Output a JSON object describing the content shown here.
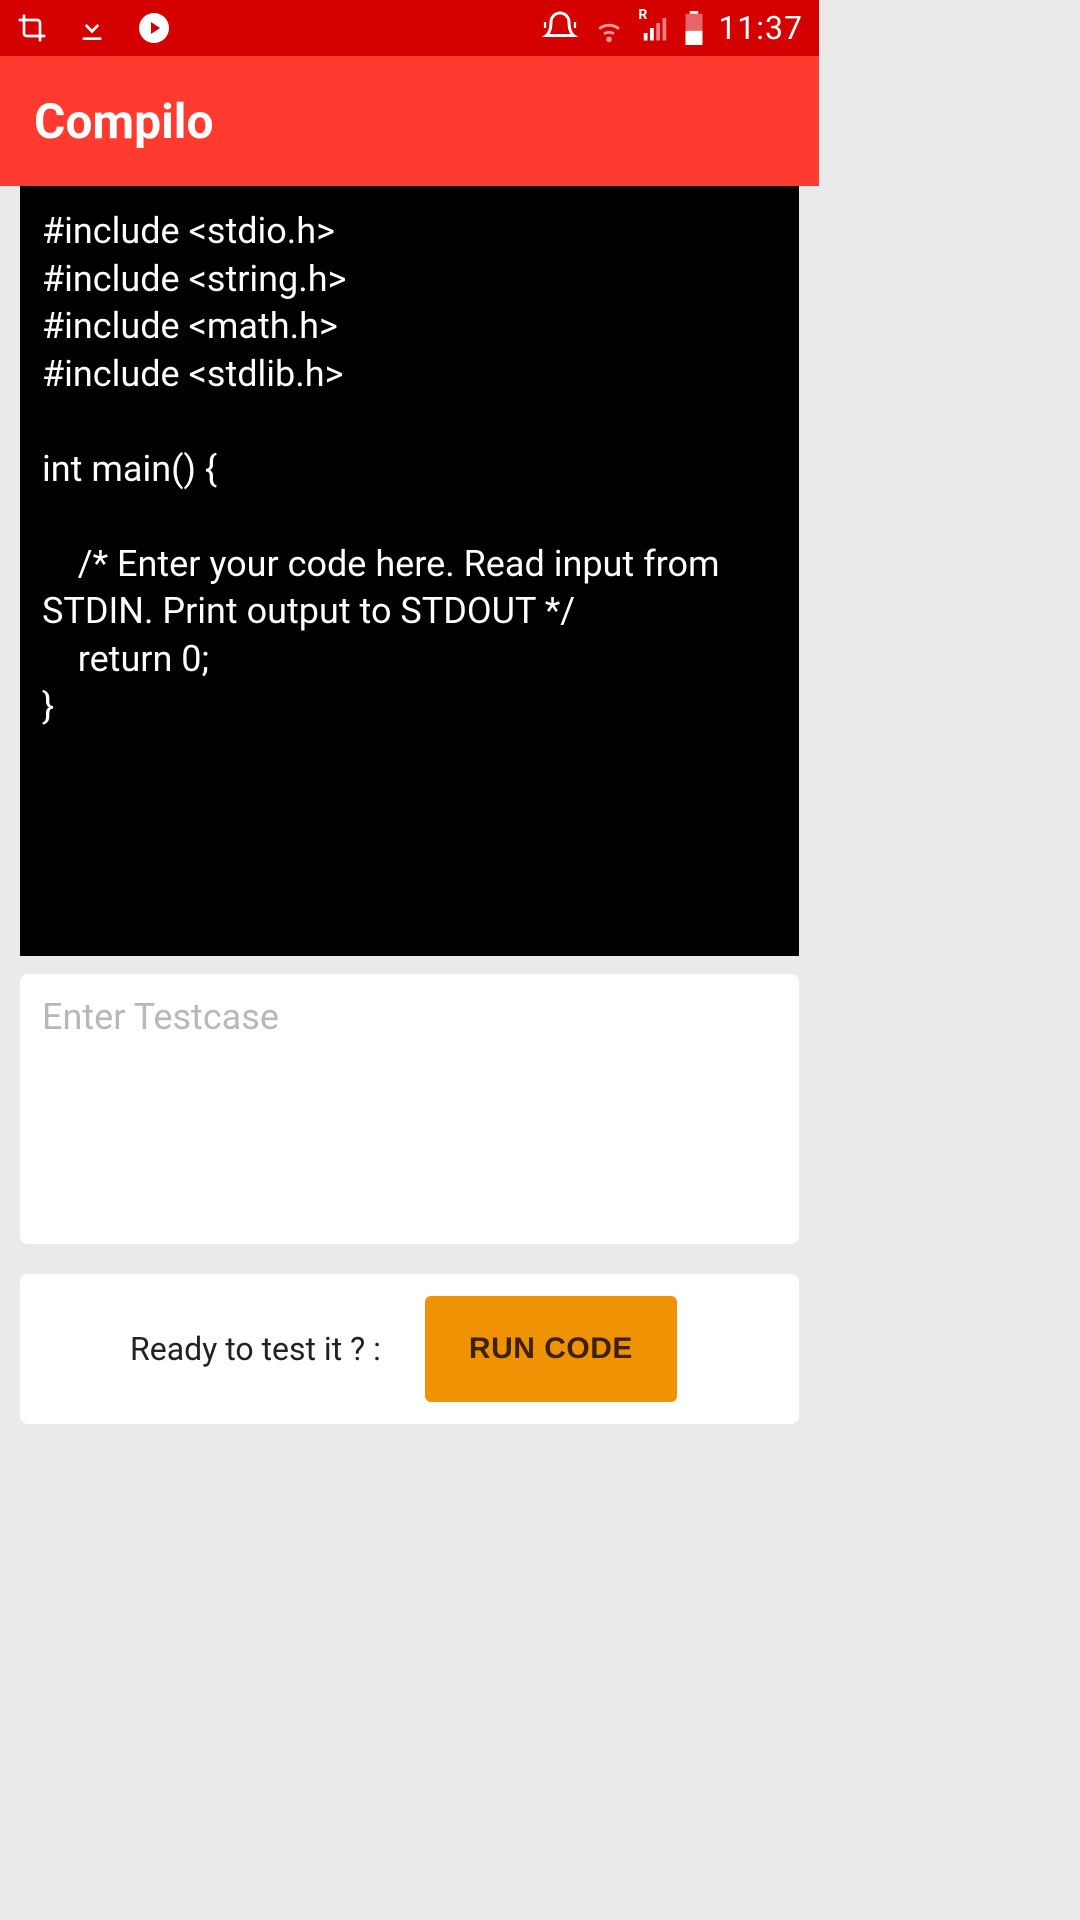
{
  "status": {
    "time": "11:37",
    "signal_label": "R"
  },
  "header": {
    "title": "Compilo"
  },
  "editor": {
    "code": "#include <stdio.h>\n#include <string.h>\n#include <math.h>\n#include <stdlib.h>\n\nint main() {\n\n    /* Enter your code here. Read input from STDIN. Print output to STDOUT */\n    return 0;\n}"
  },
  "testcase": {
    "placeholder": "Enter Testcase",
    "value": ""
  },
  "run": {
    "label": "Ready to test it ?  :",
    "button_label": "RUN CODE"
  }
}
